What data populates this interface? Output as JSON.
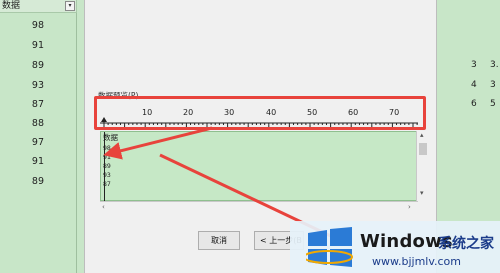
{
  "spreadsheet": {
    "column_header": "数据",
    "filter_icon": "chevron-down-icon",
    "values": [
      "98",
      "91",
      "89",
      "93",
      "87",
      "88",
      "97",
      "91",
      "89"
    ],
    "right_values": [
      {
        "a": "3",
        "b": "3."
      },
      {
        "a": "4",
        "b": "3"
      },
      {
        "a": "6",
        "b": "5"
      }
    ]
  },
  "dialog": {
    "preview_label": "数据预览(P)",
    "ruler_marks": [
      "10",
      "20",
      "30",
      "40",
      "50",
      "60",
      "70"
    ],
    "preview_rows": [
      "数据",
      "98",
      "91",
      "89",
      "93",
      "87"
    ],
    "buttons": {
      "cancel": "取消",
      "back": "< 上一步(B"
    }
  },
  "watermark": {
    "brand": "Windows",
    "cn": "系统之家",
    "url": "www.bjjmlv.com"
  },
  "colors": {
    "highlight": "#e8433c",
    "sheet_bg": "#c8e6c8",
    "watermark_blue": "#1b3c8a"
  }
}
